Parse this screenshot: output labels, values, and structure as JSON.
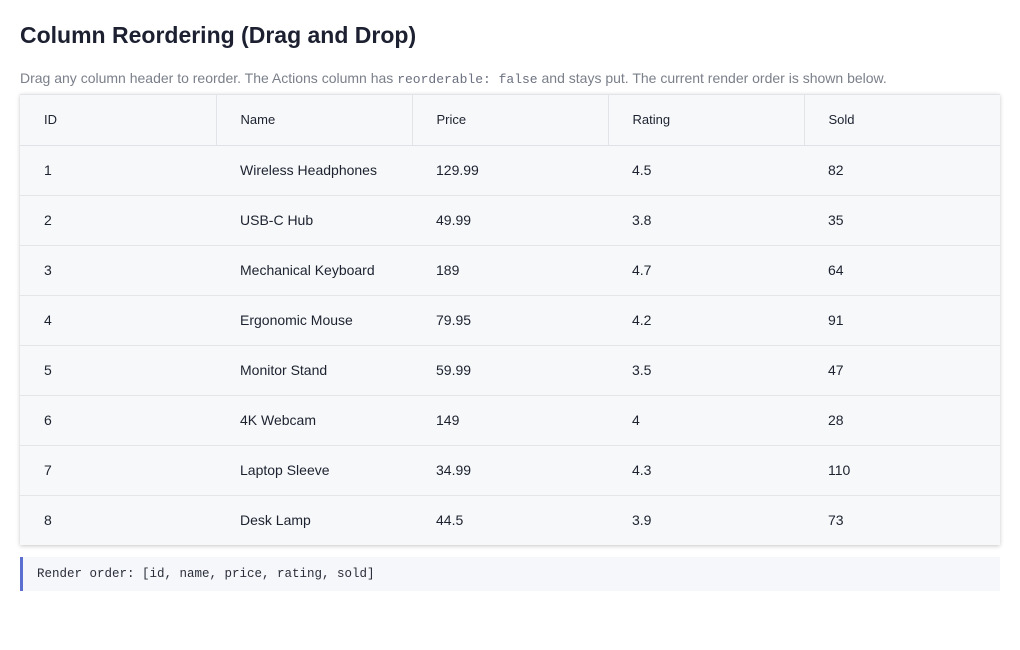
{
  "header": {
    "title": "Column Reordering (Drag and Drop)",
    "subtitle_before": "Drag any column header to reorder. The Actions column has ",
    "subtitle_code": "reorderable: false",
    "subtitle_after": " and stays put. The current render order is shown below."
  },
  "grid": {
    "columns": [
      "ID",
      "Name",
      "Price",
      "Rating",
      "Sold"
    ],
    "rows": [
      [
        "1",
        "Wireless Headphones",
        "129.99",
        "4.5",
        "82"
      ],
      [
        "2",
        "USB-C Hub",
        "49.99",
        "3.8",
        "35"
      ],
      [
        "3",
        "Mechanical Keyboard",
        "189",
        "4.7",
        "64"
      ],
      [
        "4",
        "Ergonomic Mouse",
        "79.95",
        "4.2",
        "91"
      ],
      [
        "5",
        "Monitor Stand",
        "59.99",
        "3.5",
        "47"
      ],
      [
        "6",
        "4K Webcam",
        "149",
        "4",
        "28"
      ],
      [
        "7",
        "Laptop Sleeve",
        "34.99",
        "4.3",
        "110"
      ],
      [
        "8",
        "Desk Lamp",
        "44.5",
        "3.9",
        "73"
      ]
    ]
  },
  "render_order": "Render order: [id, name, price, rating, sold]"
}
